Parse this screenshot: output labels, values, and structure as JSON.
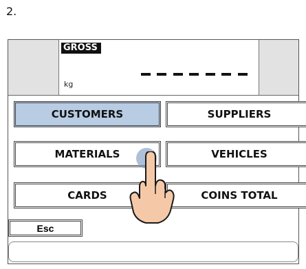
{
  "step": "2.",
  "display": {
    "gross_label": "GROSS",
    "unit": "kg",
    "value": "-------"
  },
  "buttons": [
    {
      "label": "CUSTOMERS"
    },
    {
      "label": "SUPPLIERS"
    },
    {
      "label": "MATERIALS"
    },
    {
      "label": "VEHICLES"
    },
    {
      "label": "CARDS"
    },
    {
      "label": "COINS TOTAL"
    }
  ],
  "esc_label": "Esc",
  "status_text": "",
  "colors": {
    "selected_button": "#b8cce4",
    "display_side_panels": "#e2e2e2"
  },
  "indicator": {
    "icon": "hand-pointer-icon",
    "target": "CUSTOMERS"
  }
}
